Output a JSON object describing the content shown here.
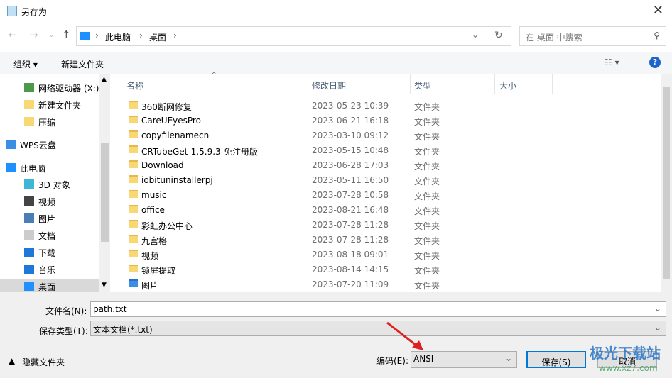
{
  "window": {
    "title": "另存为",
    "close": "✕"
  },
  "address": {
    "segments": [
      "此电脑",
      "桌面"
    ],
    "search_placeholder": "在 桌面 中搜索"
  },
  "toolbar": {
    "organize": "组织 ▾",
    "new_folder": "新建文件夹"
  },
  "nav": [
    {
      "label": "网络驱动器 (X:)",
      "icon": "network-drive-icon"
    },
    {
      "label": "新建文件夹",
      "icon": "folder-icon"
    },
    {
      "label": "压缩",
      "icon": "folder-icon"
    },
    {
      "label": "WPS云盘",
      "icon": "cloud-icon"
    },
    {
      "label": "此电脑",
      "icon": "computer-icon"
    },
    {
      "label": "3D 对象",
      "icon": "3d-objects-icon"
    },
    {
      "label": "视频",
      "icon": "video-icon"
    },
    {
      "label": "图片",
      "icon": "pictures-icon"
    },
    {
      "label": "文档",
      "icon": "documents-icon"
    },
    {
      "label": "下载",
      "icon": "download-icon"
    },
    {
      "label": "音乐",
      "icon": "music-icon"
    },
    {
      "label": "桌面",
      "icon": "desktop-icon"
    }
  ],
  "columns": {
    "name": "名称",
    "date": "修改日期",
    "type": "类型",
    "size": "大小"
  },
  "files": [
    {
      "name": "360断网修复",
      "date": "2023-05-23 10:39",
      "type": "文件夹"
    },
    {
      "name": "CareUEyesPro",
      "date": "2023-06-21 16:18",
      "type": "文件夹"
    },
    {
      "name": "copyfilenamecn",
      "date": "2023-03-10 09:12",
      "type": "文件夹"
    },
    {
      "name": "CRTubeGet-1.5.9.3-免注册版",
      "date": "2023-05-15 10:48",
      "type": "文件夹"
    },
    {
      "name": "Download",
      "date": "2023-06-28 17:03",
      "type": "文件夹"
    },
    {
      "name": "iobituninstallerpj",
      "date": "2023-05-11 16:50",
      "type": "文件夹"
    },
    {
      "name": "music",
      "date": "2023-07-28 10:58",
      "type": "文件夹"
    },
    {
      "name": "office",
      "date": "2023-08-21 16:48",
      "type": "文件夹"
    },
    {
      "name": "彩虹办公中心",
      "date": "2023-07-28 11:28",
      "type": "文件夹"
    },
    {
      "name": "九宫格",
      "date": "2023-07-28 11:28",
      "type": "文件夹"
    },
    {
      "name": "视频",
      "date": "2023-08-18 09:01",
      "type": "文件夹"
    },
    {
      "name": "锁屏提取",
      "date": "2023-08-14 14:15",
      "type": "文件夹"
    },
    {
      "name": "图片",
      "date": "2023-07-20 11:09",
      "type": "文件夹"
    }
  ],
  "form": {
    "filename_label": "文件名(N):",
    "filename": "path.txt",
    "type_label": "保存类型(T):",
    "type_value": "文本文档(*.txt)",
    "encoding_label": "编码(E):",
    "encoding": "ANSI"
  },
  "buttons": {
    "hide_folders": "隐藏文件夹",
    "save": "保存(S)",
    "cancel": "取消"
  },
  "watermark": {
    "text": "极光下载站",
    "url": "www.xz7.com"
  }
}
